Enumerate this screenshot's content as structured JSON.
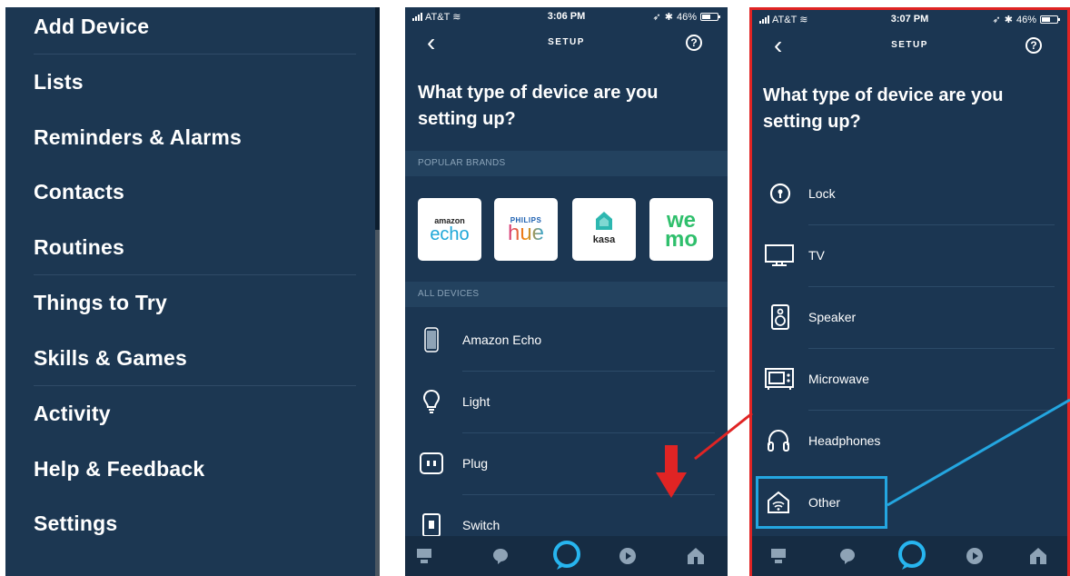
{
  "menu": {
    "items": [
      {
        "label": "Add Device"
      },
      {
        "label": "Lists"
      },
      {
        "label": "Reminders & Alarms"
      },
      {
        "label": "Contacts"
      },
      {
        "label": "Routines"
      },
      {
        "label": "Things to Try"
      },
      {
        "label": "Skills & Games"
      },
      {
        "label": "Activity"
      },
      {
        "label": "Help & Feedback"
      },
      {
        "label": "Settings"
      }
    ]
  },
  "phone_a": {
    "status": {
      "carrier": "AT&T",
      "time": "3:06 PM",
      "battery": "46%"
    },
    "nav": {
      "back": "‹",
      "title": "SETUP",
      "help": "?"
    },
    "question": "What type of device are you setting up?",
    "popular_header": "POPULAR BRANDS",
    "brands": [
      {
        "line1": "amazon",
        "line2": "echo",
        "icon": "amazon-echo-logo"
      },
      {
        "line1": "PHILIPS",
        "line2": "hue",
        "icon": "philips-hue-logo"
      },
      {
        "line1": "",
        "line2": "kasa",
        "icon": "kasa-logo"
      },
      {
        "line1": "",
        "line2": "we mo",
        "icon": "wemo-logo"
      }
    ],
    "all_header": "ALL DEVICES",
    "devices": [
      {
        "label": "Amazon Echo",
        "icon": "echo-speaker-icon"
      },
      {
        "label": "Light",
        "icon": "lightbulb-icon"
      },
      {
        "label": "Plug",
        "icon": "plug-icon"
      },
      {
        "label": "Switch",
        "icon": "switch-icon"
      }
    ]
  },
  "phone_b": {
    "status": {
      "carrier": "AT&T",
      "time": "3:07 PM",
      "battery": "46%"
    },
    "nav": {
      "back": "‹",
      "title": "SETUP",
      "help": "?"
    },
    "question": "What type of device are you setting up?",
    "devices": [
      {
        "label": "Lock",
        "icon": "lock-icon"
      },
      {
        "label": "TV",
        "icon": "tv-icon"
      },
      {
        "label": "Speaker",
        "icon": "speaker-icon"
      },
      {
        "label": "Microwave",
        "icon": "microwave-icon"
      },
      {
        "label": "Headphones",
        "icon": "headphones-icon"
      },
      {
        "label": "Other",
        "icon": "home-wifi-icon"
      }
    ]
  },
  "tabs": [
    "home-tab",
    "communicate-tab",
    "alexa-tab",
    "play-tab",
    "devices-tab"
  ],
  "colors": {
    "panel_bg": "#1b3652",
    "menu_bg": "#1c3752",
    "accent_blue": "#24a6e0",
    "alexa_ring": "#27b5ef",
    "annotation_red": "#e02424"
  }
}
